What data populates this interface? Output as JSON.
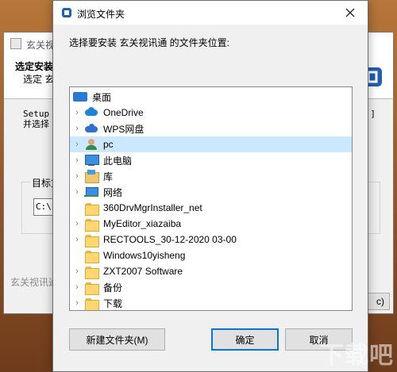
{
  "background_window": {
    "title": "玄关视讯",
    "heading": "选定安装",
    "subheading": "选定 玄",
    "setup_text": "Setup ",
    "setup_text2": "并选择",
    "bracket": "[...]",
    "group_label": "目标文",
    "path_value": "C:\\P",
    "footer_text": "玄关视讯通",
    "cancel_fragment": "c)",
    "edge_text": "i\ni\ne"
  },
  "dialog": {
    "title": "浏览文件夹",
    "prompt": "选择要安装 玄关视讯通 的文件夹位置:",
    "tree": [
      {
        "label": "桌面",
        "icon": "desktop-icon",
        "expandable": false,
        "selected": false,
        "level": 0
      },
      {
        "label": "OneDrive",
        "icon": "onedrive-icon",
        "expandable": true,
        "selected": false,
        "level": 1
      },
      {
        "label": "WPS网盘",
        "icon": "wps-cloud-icon",
        "expandable": true,
        "selected": false,
        "level": 1
      },
      {
        "label": "pc",
        "icon": "user-icon",
        "expandable": true,
        "selected": true,
        "level": 1
      },
      {
        "label": "此电脑",
        "icon": "computer-icon",
        "expandable": true,
        "selected": false,
        "level": 1
      },
      {
        "label": "库",
        "icon": "library-icon",
        "expandable": true,
        "selected": false,
        "level": 1
      },
      {
        "label": "网络",
        "icon": "network-icon",
        "expandable": true,
        "selected": false,
        "level": 1
      },
      {
        "label": "360DrvMgrInstaller_net",
        "icon": "folder-icon",
        "expandable": false,
        "selected": false,
        "level": 1
      },
      {
        "label": "MyEditor_xiazaiba",
        "icon": "folder-icon",
        "expandable": true,
        "selected": false,
        "level": 1
      },
      {
        "label": "RECTOOLS_30-12-2020 03-00",
        "icon": "folder-icon",
        "expandable": true,
        "selected": false,
        "level": 1
      },
      {
        "label": "Windows10yisheng",
        "icon": "folder-icon",
        "expandable": false,
        "selected": false,
        "level": 1
      },
      {
        "label": "ZXT2007 Software",
        "icon": "folder-icon",
        "expandable": true,
        "selected": false,
        "level": 1
      },
      {
        "label": "备份",
        "icon": "folder-icon",
        "expandable": true,
        "selected": false,
        "level": 1
      },
      {
        "label": "下载",
        "icon": "folder-icon",
        "expandable": true,
        "selected": false,
        "level": 1
      }
    ],
    "buttons": {
      "new_folder": "新建文件夹(M)",
      "ok": "确定",
      "cancel": "取消"
    }
  },
  "watermark": "下载吧",
  "colors": {
    "selection": "#cce8ff",
    "primary_border": "#0078d7",
    "folder": "#ffd76e"
  }
}
